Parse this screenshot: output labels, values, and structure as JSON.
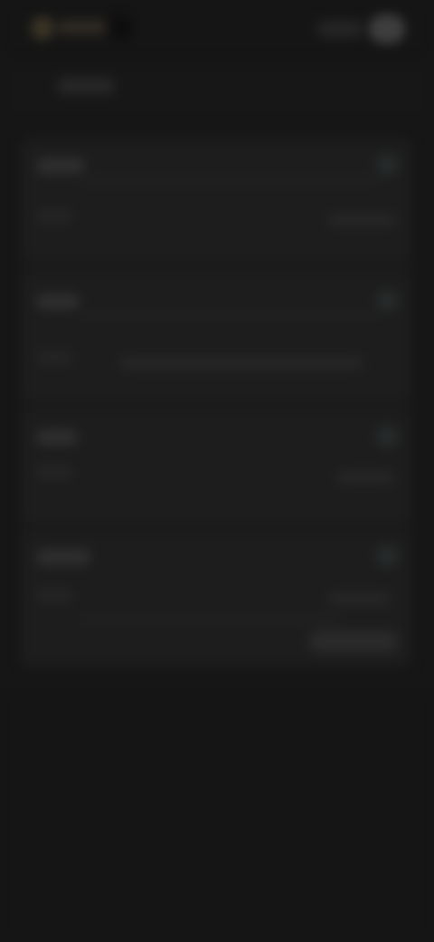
{
  "header": {
    "logo_icon": "logo-icon",
    "avatar_icon": "avatar-icon"
  },
  "colors": {
    "background": "#161616",
    "card": "#1d1d1d",
    "accent": "#3a3325"
  }
}
